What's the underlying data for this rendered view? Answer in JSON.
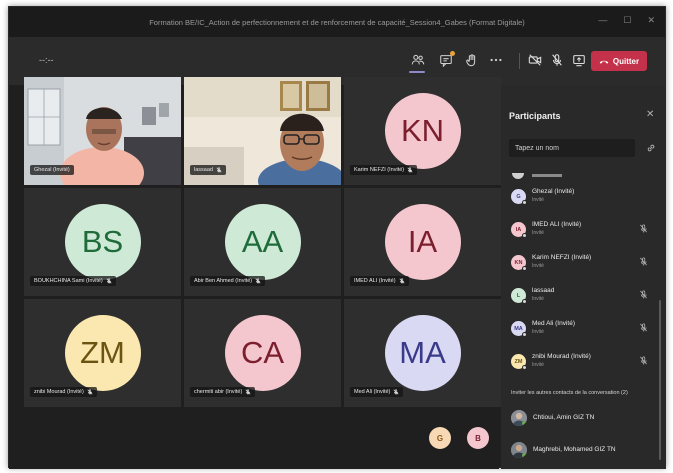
{
  "window": {
    "title": "Formation BE/IC_Action de perfectionnement et de renforcement de capacité_Session4_Gabes (Format Digitale)",
    "controls": [
      "—",
      "☐",
      "✕"
    ]
  },
  "toolbar": {
    "timer": "--:--",
    "leave_label": "Quitter",
    "icons": [
      "participants-icon",
      "chat-icon",
      "raise-hand-icon",
      "more-icon",
      "camera-off-icon",
      "mic-off-icon",
      "share-icon"
    ]
  },
  "tiles": [
    {
      "name": "Ghezal (Invité)",
      "type": "video",
      "muted": false
    },
    {
      "name": "lassaad",
      "type": "video",
      "muted": true
    },
    {
      "name": "Karim NEFZI (Invité)",
      "type": "avatar",
      "initials": "KN",
      "bg": "#f4c7cf",
      "fg": "#7b1e2e",
      "muted": true
    },
    {
      "name": "BOUKHCHINA Sami (Invité)",
      "type": "avatar",
      "initials": "BS",
      "bg": "#cfe9d7",
      "fg": "#1f6b3a",
      "muted": true
    },
    {
      "name": "Abir Ben Ahmed (Invité)",
      "type": "avatar",
      "initials": "AA",
      "bg": "#cfe9d7",
      "fg": "#1f6b3a",
      "muted": true
    },
    {
      "name": "IMED ALI (Invité)",
      "type": "avatar",
      "initials": "IA",
      "bg": "#f4c7cf",
      "fg": "#7b1e2e",
      "muted": true
    },
    {
      "name": "znibi Mourad (Invité)",
      "type": "avatar",
      "initials": "ZM",
      "bg": "#fbe8b0",
      "fg": "#6b5410",
      "muted": true
    },
    {
      "name": "chermiti abir (Invité)",
      "type": "avatar",
      "initials": "CA",
      "bg": "#f4c7cf",
      "fg": "#7b1e2e",
      "muted": true
    },
    {
      "name": "Med Ali (Invité)",
      "type": "avatar",
      "initials": "MA",
      "bg": "#d9d9f3",
      "fg": "#3a3a8a",
      "muted": true
    }
  ],
  "overflow_avatars": [
    {
      "initials": "G",
      "bg": "#f7d9b5",
      "fg": "#8a5a1a"
    },
    {
      "initials": "B",
      "bg": "#f4c7cf",
      "fg": "#7b1e2e"
    }
  ],
  "panel": {
    "title": "Participants",
    "search_placeholder": "Tapez un nom",
    "participants": [
      {
        "name": "Ghezal (Invité)",
        "role": "Invité",
        "initials": "G",
        "bg": "#d9d9f3",
        "fg": "#3a3a8a",
        "muted": false
      },
      {
        "name": "IMED ALI (Invité)",
        "role": "Invité",
        "initials": "IA",
        "bg": "#f4c7cf",
        "fg": "#7b1e2e",
        "muted": true
      },
      {
        "name": "Karim NEFZI (Invité)",
        "role": "Invité",
        "initials": "KN",
        "bg": "#f4c7cf",
        "fg": "#7b1e2e",
        "muted": true
      },
      {
        "name": "lassaad",
        "role": "Invité",
        "initials": "L",
        "bg": "#cfe9d7",
        "fg": "#1f6b3a",
        "muted": true
      },
      {
        "name": "Med Ali (Invité)",
        "role": "Invité",
        "initials": "MA",
        "bg": "#d9d9f3",
        "fg": "#3a3a8a",
        "muted": true
      },
      {
        "name": "znibi Mourad (Invité)",
        "role": "Invité",
        "initials": "ZM",
        "bg": "#fbe8b0",
        "fg": "#6b5410",
        "muted": true
      }
    ],
    "invite_label": "Inviter les autres contacts de la conversation (2)",
    "contacts": [
      {
        "name": "Chtioui, Amin GIZ TN"
      },
      {
        "name": "Maghrebi, Mohamed GIZ TN"
      }
    ]
  },
  "colors": {
    "leave": "#c4314b",
    "accent": "#8b8cc7",
    "notification": "#e8a23a"
  }
}
